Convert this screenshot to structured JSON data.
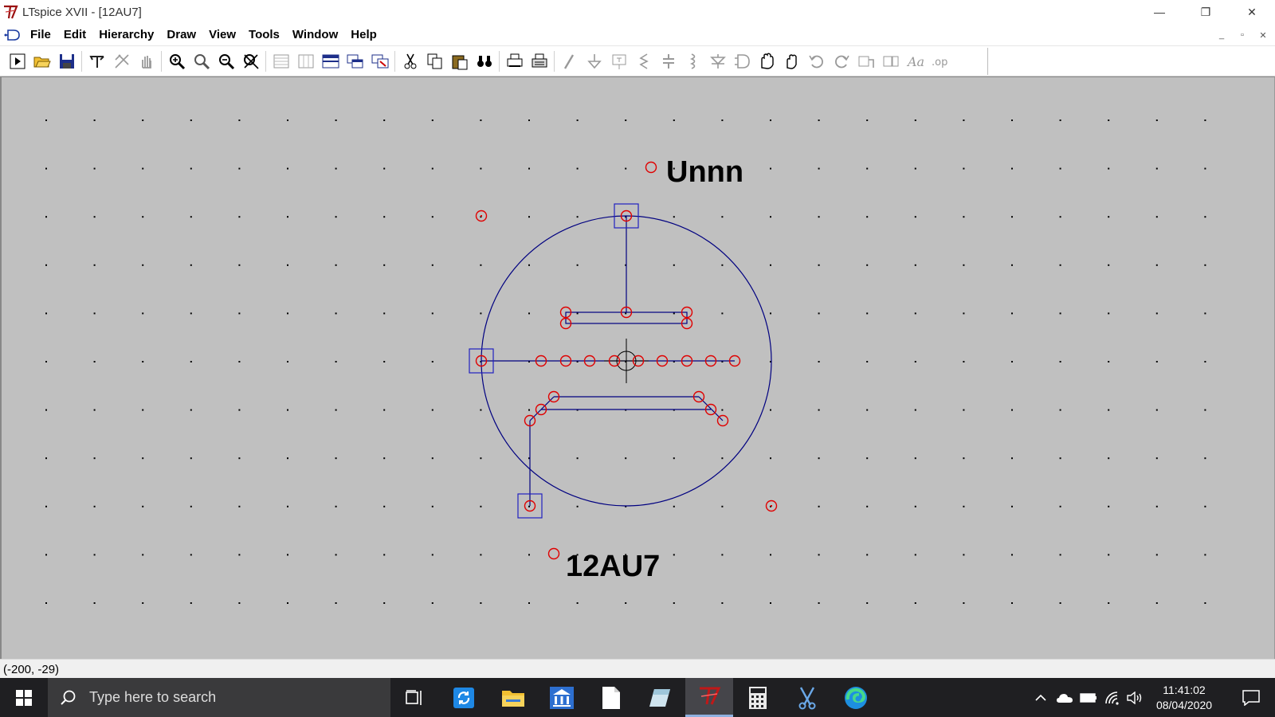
{
  "window": {
    "title": "LTspice XVII - [12AU7]",
    "minimize": "—",
    "restore": "❐",
    "close": "✕"
  },
  "menu": {
    "items": [
      "File",
      "Edit",
      "Hierarchy",
      "Draw",
      "View",
      "Tools",
      "Window",
      "Help"
    ],
    "mdi_minimize": "_",
    "mdi_restore": "▫",
    "mdi_close": "✕"
  },
  "toolbar": {
    "buttons": [
      "run-icon",
      "open-icon",
      "save-icon",
      "control-panel-icon",
      "halt-icon",
      "pan-icon",
      "zoom-in-icon",
      "zoom-area-icon",
      "zoom-out-icon",
      "zoom-fit-icon",
      "tile-horizontal-icon",
      "tile-vertical-icon",
      "cascade-icon",
      "close-windows-icon",
      "reorder-icon",
      "cut-icon",
      "copy-icon",
      "paste-icon",
      "find-icon",
      "print-preview-icon",
      "print-icon",
      "draw-wire-icon",
      "ground-icon",
      "label-net-icon",
      "resistor-icon",
      "capacitor-icon",
      "inductor-icon",
      "diode-icon",
      "component-icon",
      "move-icon",
      "drag-icon",
      "undo-icon",
      "redo-icon",
      "rotate-icon",
      "mirror-icon",
      "text-icon",
      "spice-directive-icon"
    ]
  },
  "schematic": {
    "prefix_label": "Unnn",
    "value_label": "12AU7",
    "colors": {
      "background": "#c0c0c0",
      "grid": "#000000",
      "line": "#000080",
      "pin_circle": "#e00000",
      "pin_box": "#2020c0"
    }
  },
  "status": {
    "coords": "(-200, -29)"
  },
  "taskbar": {
    "search_placeholder": "Type here to search",
    "time": "11:41:02",
    "date": "08/04/2020"
  }
}
